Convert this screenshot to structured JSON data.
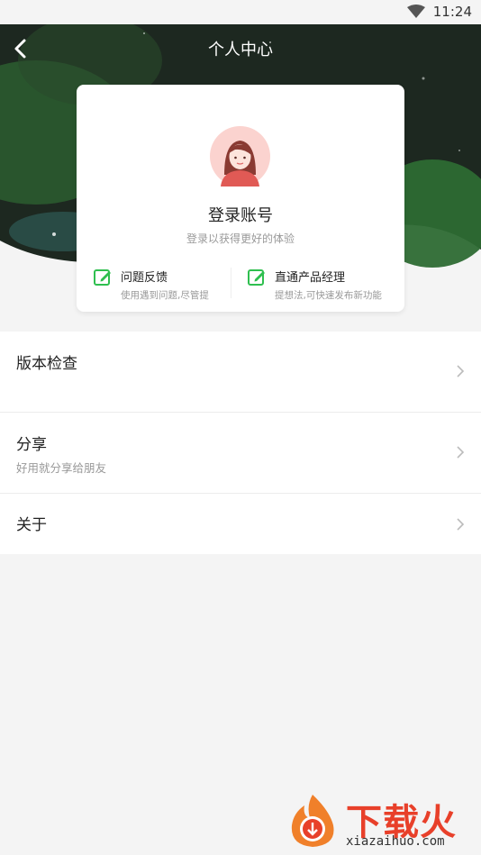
{
  "status_bar": {
    "time": "11:24",
    "wifi_icon": "wifi-icon"
  },
  "header": {
    "title": "个人中心",
    "back_icon": "back-arrow-icon"
  },
  "profile": {
    "login_title": "登录账号",
    "login_subtitle": "登录以获得更好的体验",
    "avatar_icon": "avatar-girl-icon",
    "actions": [
      {
        "title": "问题反馈",
        "subtitle": "使用遇到问题,尽管提",
        "icon": "edit-icon"
      },
      {
        "title": "直通产品经理",
        "subtitle": "提想法,可快速发布新功能",
        "icon": "edit-icon"
      }
    ]
  },
  "menu": {
    "items": [
      {
        "title": "版本检查",
        "subtitle": ""
      },
      {
        "title": "分享",
        "subtitle": "好用就分享给朋友"
      },
      {
        "title": "关于",
        "subtitle": ""
      }
    ]
  },
  "watermark": {
    "brand": "下载火",
    "url": "xiazaihuo.com"
  },
  "colors": {
    "accent": "#2fbf4f",
    "hero_dark": "#1c2720",
    "hero_green": "#2f6b34",
    "background": "#f4f4f4"
  }
}
